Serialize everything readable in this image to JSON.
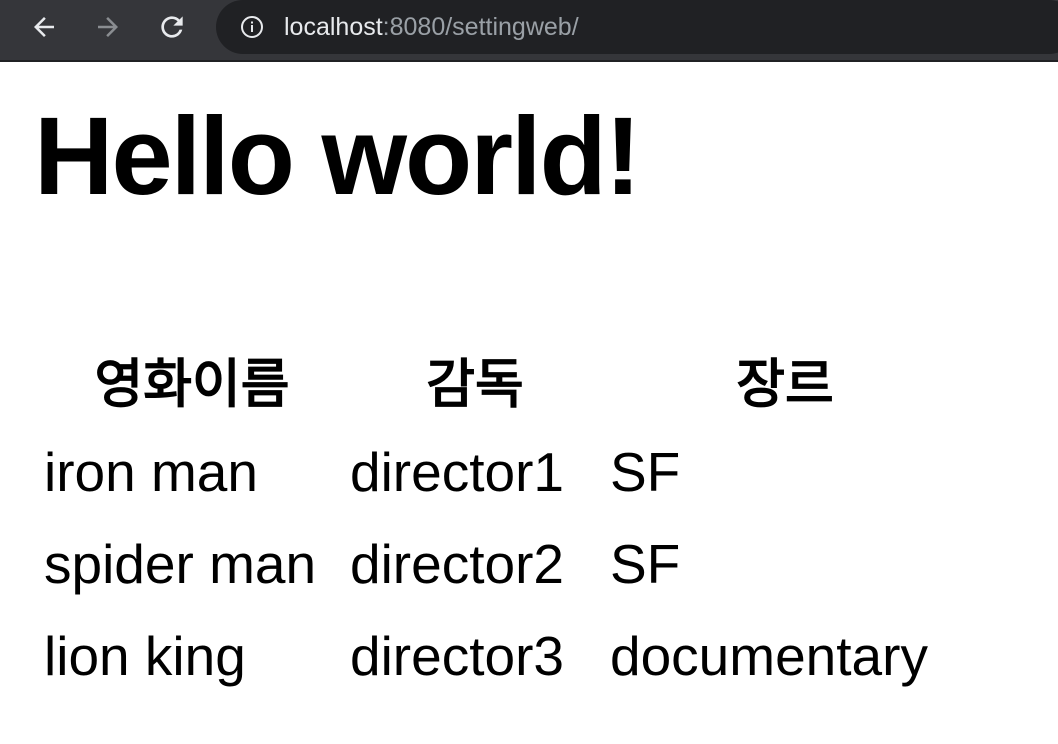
{
  "browser": {
    "url_host": "localhost",
    "url_rest": ":8080/settingweb/",
    "back_icon": "back-arrow-icon",
    "forward_icon": "forward-arrow-icon",
    "reload_icon": "reload-icon",
    "info_icon": "info-icon"
  },
  "page": {
    "title": "Hello world!"
  },
  "table": {
    "headers": [
      "영화이름",
      "감독",
      "장르"
    ],
    "rows": [
      [
        "iron man",
        "director1",
        "SF"
      ],
      [
        "spider man",
        "director2",
        "SF"
      ],
      [
        "lion king",
        "director3",
        "documentary"
      ]
    ]
  }
}
